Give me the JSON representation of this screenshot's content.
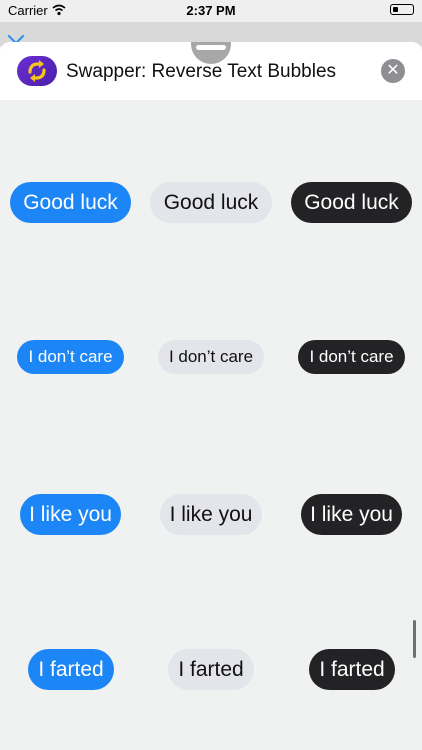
{
  "status": {
    "carrier": "Carrier",
    "time": "2:37 PM"
  },
  "header": {
    "title": "Swapper: Reverse Text Bubbles",
    "close_glyph": "✕"
  },
  "colors": {
    "blue_bubble": "#1d86f7",
    "gray_bubble": "#e4e5ea",
    "dark_bubble": "#232326"
  },
  "rows": [
    {
      "blue": "Good luck",
      "gray": "Good luck",
      "dark": "Good luck"
    },
    {
      "blue": "I don’t care",
      "gray": "I don’t care",
      "dark": "I don’t care"
    },
    {
      "blue": "I like you",
      "gray": "I like you",
      "dark": "I like you"
    },
    {
      "blue": "I farted",
      "gray": "I farted",
      "dark": "I farted"
    }
  ]
}
